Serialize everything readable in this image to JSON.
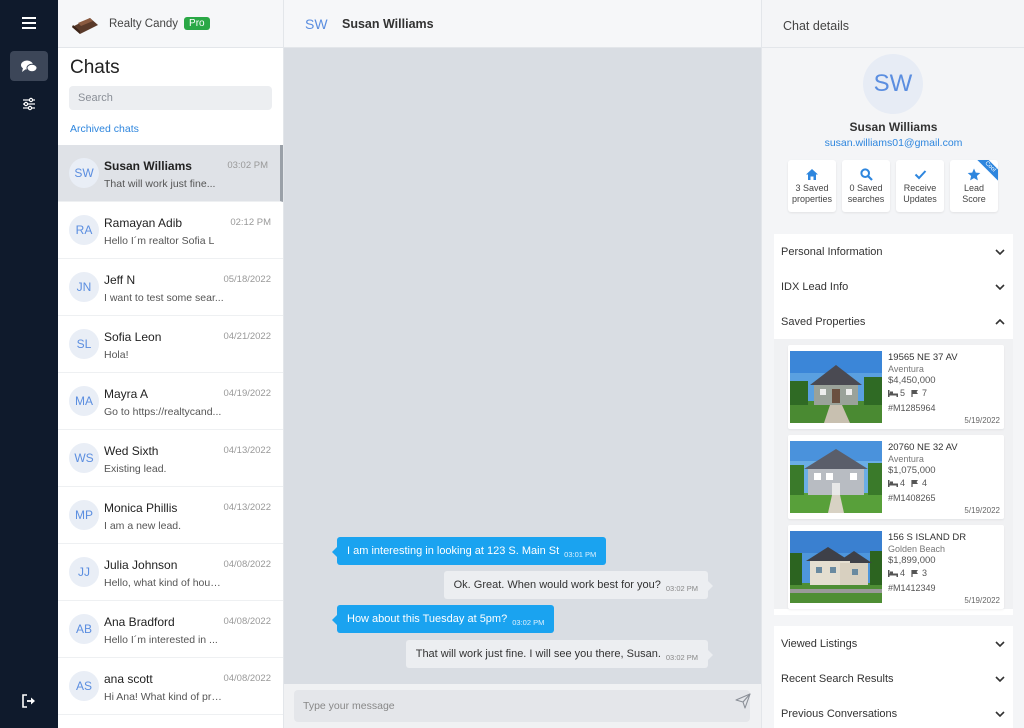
{
  "brand": {
    "name": "Realty Candy",
    "badge": "Pro"
  },
  "chat_list": {
    "title": "Chats",
    "search_placeholder": "Search",
    "archived_label": "Archived chats",
    "items": [
      {
        "initials": "SW",
        "name": "Susan Williams",
        "date": "03:02 PM",
        "preview": "That will work just fine..."
      },
      {
        "initials": "RA",
        "name": "Ramayan Adib",
        "date": "02:12 PM",
        "preview": "Hello I´m realtor Sofia L"
      },
      {
        "initials": "JN",
        "name": "Jeff N",
        "date": "05/18/2022",
        "preview": "I want to test some sear..."
      },
      {
        "initials": "SL",
        "name": "Sofia Leon",
        "date": "04/21/2022",
        "preview": "Hola!"
      },
      {
        "initials": "MA",
        "name": "Mayra A",
        "date": "04/19/2022",
        "preview": "Go to https://realtycand..."
      },
      {
        "initials": "WS",
        "name": "Wed Sixth",
        "date": "04/13/2022",
        "preview": "Existing lead."
      },
      {
        "initials": "MP",
        "name": "Monica Phillis",
        "date": "04/13/2022",
        "preview": "I am a new lead."
      },
      {
        "initials": "JJ",
        "name": "Julia Johnson",
        "date": "04/08/2022",
        "preview": "Hello, what kind of hous..."
      },
      {
        "initials": "AB",
        "name": "Ana Bradford",
        "date": "04/08/2022",
        "preview": "Hello I´m interested in ..."
      },
      {
        "initials": "AS",
        "name": "ana scott",
        "date": "04/08/2022",
        "preview": "Hi Ana! What kind of pro..."
      }
    ]
  },
  "conversation": {
    "initials": "SW",
    "name": "Susan Williams",
    "messages": [
      {
        "text": "I am interesting in looking at 123 S. Main St",
        "time": "03:01 PM"
      },
      {
        "text": "Ok. Great. When would work best for you?",
        "time": "03:02 PM"
      },
      {
        "text": "How about this Tuesday at 5pm?",
        "time": "03:02 PM"
      },
      {
        "text": "That will work just fine. I will see you there, Susan.",
        "time": "03:02 PM"
      }
    ],
    "input_placeholder": "Type your message"
  },
  "details": {
    "title": "Chat details",
    "initials": "SW",
    "name": "Susan Williams",
    "email": "susan.williams01@gmail.com",
    "stats": [
      {
        "line1": "3 Saved",
        "line2": "properties",
        "icon": "house-icon"
      },
      {
        "line1": "0 Saved",
        "line2": "searches",
        "icon": "search-icon"
      },
      {
        "line1": "Receive",
        "line2": "Updates",
        "icon": "check-icon"
      },
      {
        "line1": "Lead",
        "line2": "Score",
        "icon": "star-icon",
        "ribbon": "Cool"
      }
    ],
    "sections": {
      "personal": "Personal Information",
      "idx": "IDX Lead Info",
      "saved": "Saved Properties",
      "viewed": "Viewed Listings",
      "recent": "Recent Search Results",
      "previous": "Previous Conversations"
    },
    "properties": [
      {
        "address": "19565 NE 37 AV",
        "city": "Aventura",
        "price": "$4,450,000",
        "beds": "5",
        "baths": "7",
        "mls": "#M1285964",
        "date": "5/19/2022"
      },
      {
        "address": "20760 NE 32 AV",
        "city": "Aventura",
        "price": "$1,075,000",
        "beds": "4",
        "baths": "4",
        "mls": "#M1408265",
        "date": "5/19/2022"
      },
      {
        "address": "156 S ISLAND DR",
        "city": "Golden Beach",
        "price": "$1,899,000",
        "beds": "4",
        "baths": "3",
        "mls": "#M1412349",
        "date": "5/19/2022"
      }
    ]
  },
  "colors": {
    "rail": "#0f1a2c",
    "accent": "#1aa3f0",
    "link": "#2e86de",
    "pro": "#2aa846"
  }
}
